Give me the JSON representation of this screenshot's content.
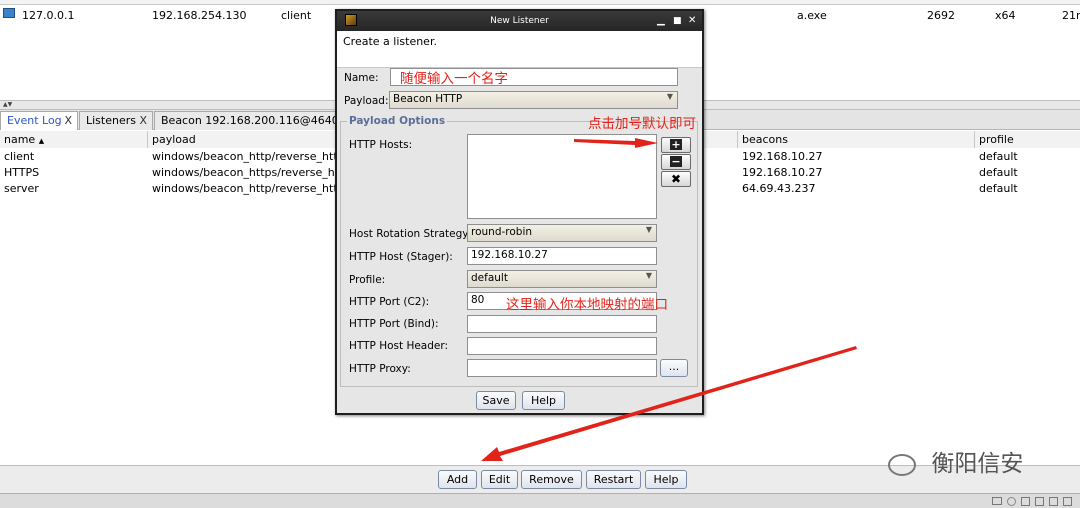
{
  "sessions_table": {
    "partial_row_visible": true,
    "row": {
      "external": "127.0.0.1",
      "internal": "192.168.254.130",
      "user": "client",
      "process": "a.exe",
      "pid": "2692",
      "arch": "x64",
      "last": "21r"
    }
  },
  "tabs": [
    {
      "label": "Event Log",
      "close": "X",
      "active": true
    },
    {
      "label": "Listeners",
      "close": "X",
      "active": false
    },
    {
      "label": "Beacon 192.168.200.116@4640",
      "close": "X",
      "active": false
    }
  ],
  "listeners_table": {
    "headers": {
      "name": "name",
      "sort": "▲",
      "payload": "payload",
      "beacons": "beacons",
      "profile": "profile"
    },
    "rows": [
      {
        "name": "client",
        "payload": "windows/beacon_http/reverse_http",
        "beacons": "192.168.10.27",
        "profile": "default"
      },
      {
        "name": "HTTPS",
        "payload": "windows/beacon_https/reverse_https",
        "beacons": "192.168.10.27",
        "profile": "default"
      },
      {
        "name": "server",
        "payload": "windows/beacon_http/reverse_http",
        "beacons": "64.69.43.237",
        "profile": "default"
      }
    ]
  },
  "bottom_buttons": {
    "add": "Add",
    "edit": "Edit",
    "remove": "Remove",
    "restart": "Restart",
    "help": "Help"
  },
  "dialog": {
    "title": "New Listener",
    "description": "Create a listener.",
    "name_label": "Name:",
    "name_value": "",
    "payload_label": "Payload:",
    "payload_value": "Beacon HTTP",
    "section_title": "Payload Options",
    "hosts_label": "HTTP Hosts:",
    "add_symbol": "+",
    "remove_symbol": "−",
    "clear_symbol": "✖",
    "rotation_label": "Host Rotation Strategy:",
    "rotation_value": "round-robin",
    "stager_label": "HTTP Host (Stager):",
    "stager_value": "192.168.10.27",
    "profile_label": "Profile:",
    "profile_value": "default",
    "port_c2_label": "HTTP Port (C2):",
    "port_c2_value": "80",
    "port_bind_label": "HTTP Port (Bind):",
    "host_header_label": "HTTP Host Header:",
    "proxy_label": "HTTP Proxy:",
    "proxy_btn": "...",
    "save": "Save",
    "help": "Help"
  },
  "annotations": {
    "name_hint": "随便输入一个名字",
    "plus_hint": "点击加号默认即可",
    "port_hint": "这里输入你本地映射的端口"
  },
  "watermark": "衡阳信安",
  "colors": {
    "annotation": "#e2231a",
    "active_tab": "#2c55c8",
    "section": "#5a6f95"
  }
}
